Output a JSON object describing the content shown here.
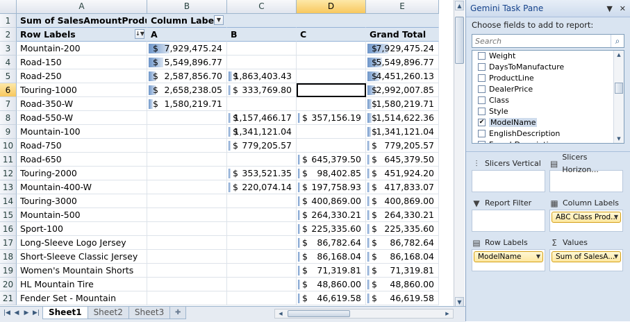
{
  "columns": [
    "A",
    "B",
    "C",
    "D",
    "E"
  ],
  "selected_column": "D",
  "pivot": {
    "value_header": "Sum of SalesAmountProduct",
    "column_labels": "Column Labels",
    "row_labels": "Row Labels",
    "col_a": "A",
    "col_b": "B",
    "col_c": "C",
    "grand_total": "Grand Total",
    "currency": "$",
    "rows": [
      {
        "num": "3",
        "label": "Mountain-200",
        "a": "7,929,475.24",
        "b": "",
        "c": "",
        "total": "7,929,475.24",
        "bar_a": 1.0,
        "bar_b": 0,
        "bar_c": 0,
        "bar_t": 1.0
      },
      {
        "num": "4",
        "label": "Road-150",
        "a": "5,549,896.77",
        "b": "",
        "c": "",
        "total": "5,549,896.77",
        "bar_a": 0.7,
        "bar_b": 0,
        "bar_c": 0,
        "bar_t": 0.7
      },
      {
        "num": "5",
        "label": "Road-250",
        "a": "2,587,856.70",
        "b": "1,863,403.43",
        "c": "",
        "total": "4,451,260.13",
        "bar_a": 0.33,
        "bar_b": 0.24,
        "bar_c": 0,
        "bar_t": 0.56
      },
      {
        "num": "6",
        "label": "Touring-1000",
        "a": "2,658,238.05",
        "b": "333,769.80",
        "c": "",
        "total": "2,992,007.85",
        "bar_a": 0.34,
        "bar_b": 0.04,
        "bar_c": 0,
        "bar_t": 0.38
      },
      {
        "num": "7",
        "label": "Road-350-W",
        "a": "1,580,219.71",
        "b": "",
        "c": "",
        "total": "1,580,219.71",
        "bar_a": 0.2,
        "bar_b": 0,
        "bar_c": 0,
        "bar_t": 0.2
      },
      {
        "num": "8",
        "label": "Road-550-W",
        "a": "",
        "b": "1,157,466.17",
        "c": "357,156.19",
        "total": "1,514,622.36",
        "bar_a": 0,
        "bar_b": 0.15,
        "bar_c": 0.05,
        "bar_t": 0.19
      },
      {
        "num": "9",
        "label": "Mountain-100",
        "a": "",
        "b": "1,341,121.04",
        "c": "",
        "total": "1,341,121.04",
        "bar_a": 0,
        "bar_b": 0.17,
        "bar_c": 0,
        "bar_t": 0.17
      },
      {
        "num": "10",
        "label": "Road-750",
        "a": "",
        "b": "779,205.57",
        "c": "",
        "total": "779,205.57",
        "bar_a": 0,
        "bar_b": 0.1,
        "bar_c": 0,
        "bar_t": 0.1
      },
      {
        "num": "11",
        "label": "Road-650",
        "a": "",
        "b": "",
        "c": "645,379.50",
        "total": "645,379.50",
        "bar_a": 0,
        "bar_b": 0,
        "bar_c": 0.08,
        "bar_t": 0.08
      },
      {
        "num": "12",
        "label": "Touring-2000",
        "a": "",
        "b": "353,521.35",
        "c": "98,402.85",
        "total": "451,924.20",
        "bar_a": 0,
        "bar_b": 0.05,
        "bar_c": 0.01,
        "bar_t": 0.06
      },
      {
        "num": "13",
        "label": "Mountain-400-W",
        "a": "",
        "b": "220,074.14",
        "c": "197,758.93",
        "total": "417,833.07",
        "bar_a": 0,
        "bar_b": 0.03,
        "bar_c": 0.03,
        "bar_t": 0.05
      },
      {
        "num": "14",
        "label": "Touring-3000",
        "a": "",
        "b": "",
        "c": "400,869.00",
        "total": "400,869.00",
        "bar_a": 0,
        "bar_b": 0,
        "bar_c": 0.05,
        "bar_t": 0.05
      },
      {
        "num": "15",
        "label": "Mountain-500",
        "a": "",
        "b": "",
        "c": "264,330.21",
        "total": "264,330.21",
        "bar_a": 0,
        "bar_b": 0,
        "bar_c": 0.03,
        "bar_t": 0.03
      },
      {
        "num": "16",
        "label": "Sport-100",
        "a": "",
        "b": "",
        "c": "225,335.60",
        "total": "225,335.60",
        "bar_a": 0,
        "bar_b": 0,
        "bar_c": 0.03,
        "bar_t": 0.03
      },
      {
        "num": "17",
        "label": "Long-Sleeve Logo Jersey",
        "a": "",
        "b": "",
        "c": "86,782.64",
        "total": "86,782.64",
        "bar_a": 0,
        "bar_b": 0,
        "bar_c": 0,
        "bar_t": 0
      },
      {
        "num": "18",
        "label": "Short-Sleeve Classic Jersey",
        "a": "",
        "b": "",
        "c": "86,168.04",
        "total": "86,168.04",
        "bar_a": 0,
        "bar_b": 0,
        "bar_c": 0,
        "bar_t": 0
      },
      {
        "num": "19",
        "label": "Women's Mountain Shorts",
        "a": "",
        "b": "",
        "c": "71,319.81",
        "total": "71,319.81",
        "bar_a": 0,
        "bar_b": 0,
        "bar_c": 0,
        "bar_t": 0
      },
      {
        "num": "20",
        "label": "HL Mountain Tire",
        "a": "",
        "b": "",
        "c": "48,860.00",
        "total": "48,860.00",
        "bar_a": 0,
        "bar_b": 0,
        "bar_c": 0,
        "bar_t": 0
      },
      {
        "num": "21",
        "label": "Fender Set - Mountain",
        "a": "",
        "b": "",
        "c": "46,619.58",
        "total": "46,619.58",
        "bar_a": 0,
        "bar_b": 0,
        "bar_c": 0,
        "bar_t": 0
      }
    ]
  },
  "sheet_tabs": [
    "Sheet1",
    "Sheet2",
    "Sheet3"
  ],
  "active_tab": "Sheet1",
  "pane": {
    "title": "Gemini Task Pane",
    "choose_label": "Choose fields to add to report:",
    "search_placeholder": "Search",
    "fields": [
      {
        "name": "Weight",
        "checked": false
      },
      {
        "name": "DaysToManufacture",
        "checked": false
      },
      {
        "name": "ProductLine",
        "checked": false
      },
      {
        "name": "DealerPrice",
        "checked": false
      },
      {
        "name": "Class",
        "checked": false
      },
      {
        "name": "Style",
        "checked": false
      },
      {
        "name": "ModelName",
        "checked": true
      },
      {
        "name": "EnglishDescription",
        "checked": false
      },
      {
        "name": "FrenchDescription",
        "checked": false
      }
    ],
    "zones": {
      "slicers_vertical": "Slicers Vertical",
      "slicers_horizontal": "Slicers Horizon...",
      "report_filter": "Report Filter",
      "column_labels": "Column Labels",
      "column_pill": "ABC Class Prod...",
      "row_labels": "Row Labels",
      "row_pill": "ModelName",
      "values": "Values",
      "values_pill": "Sum of SalesA..."
    }
  },
  "colors": {
    "header_fill": "#dce6f1",
    "databar": "#6d95c9",
    "pill": "#fde7a0"
  }
}
